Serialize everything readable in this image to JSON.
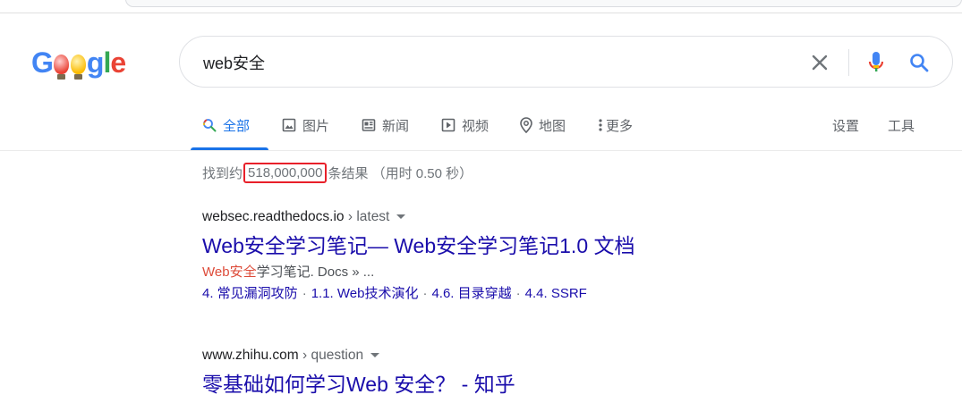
{
  "logo": {
    "alt": "Google",
    "letters": [
      "G",
      "o",
      "o",
      "g",
      "l",
      "e"
    ]
  },
  "search": {
    "query": "web安全"
  },
  "icons": {
    "clear": "close-icon",
    "mic": "microphone-icon",
    "search": "search-icon",
    "images": "image-icon",
    "news": "newspaper-icon",
    "videos": "play-icon",
    "maps": "map-pin-icon",
    "more": "more-vert-icon"
  },
  "tabs": [
    {
      "label": "全部",
      "active": true
    },
    {
      "label": "图片"
    },
    {
      "label": "新闻"
    },
    {
      "label": "视频"
    },
    {
      "label": "地图"
    },
    {
      "label": "更多"
    }
  ],
  "settings_label": "设置",
  "tools_label": "工具",
  "stats": {
    "prefix": "找到约",
    "count": "518,000,000",
    "suffix": "条结果",
    "time": "（用时 0.50 秒）"
  },
  "results": [
    {
      "domain": "websec.readthedocs.io",
      "path": " › latest",
      "title": "Web安全学习笔记— Web安全学习笔记1.0 文档",
      "snippet_highlight": "Web安全",
      "snippet_rest": "学习笔记. Docs » ...",
      "sitelinks": [
        "4. 常见漏洞攻防",
        "1.1. Web技术演化",
        "4.6. 目录穿越",
        "4.4. SSRF"
      ]
    },
    {
      "domain": "www.zhihu.com",
      "path": " › question",
      "title": "零基础如何学习Web 安全？ - 知乎"
    }
  ],
  "colors": {
    "link": "#1a0dab",
    "accent": "#1a73e8",
    "highlight_box": "#e8202a",
    "snippet_highlight": "#dd4b39"
  }
}
